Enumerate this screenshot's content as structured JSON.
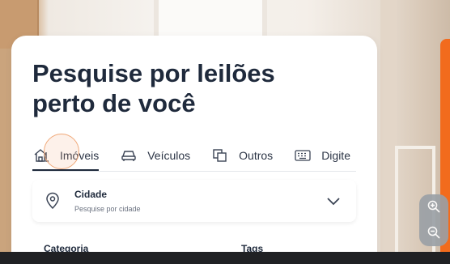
{
  "card": {
    "title": "Pesquise por leilões\nperto de você"
  },
  "tabs": [
    {
      "label": "Imóveis",
      "icon": "house-icon",
      "active": true
    },
    {
      "label": "Veículos",
      "icon": "car-icon",
      "active": false
    },
    {
      "label": "Outros",
      "icon": "copy-icon",
      "active": false
    },
    {
      "label": "Digite",
      "icon": "keyboard-icon",
      "active": false
    }
  ],
  "city_field": {
    "label": "Cidade",
    "placeholder": "Pesquise por cidade",
    "icon": "location-pin-icon"
  },
  "filters": {
    "category_label": "Categoria",
    "tags_label": "Tags"
  },
  "zoom": {
    "in_icon": "zoom-in-icon",
    "out_icon": "zoom-out-icon"
  },
  "colors": {
    "accent": "#f26b1d",
    "text_dark": "#1f2a3c"
  }
}
